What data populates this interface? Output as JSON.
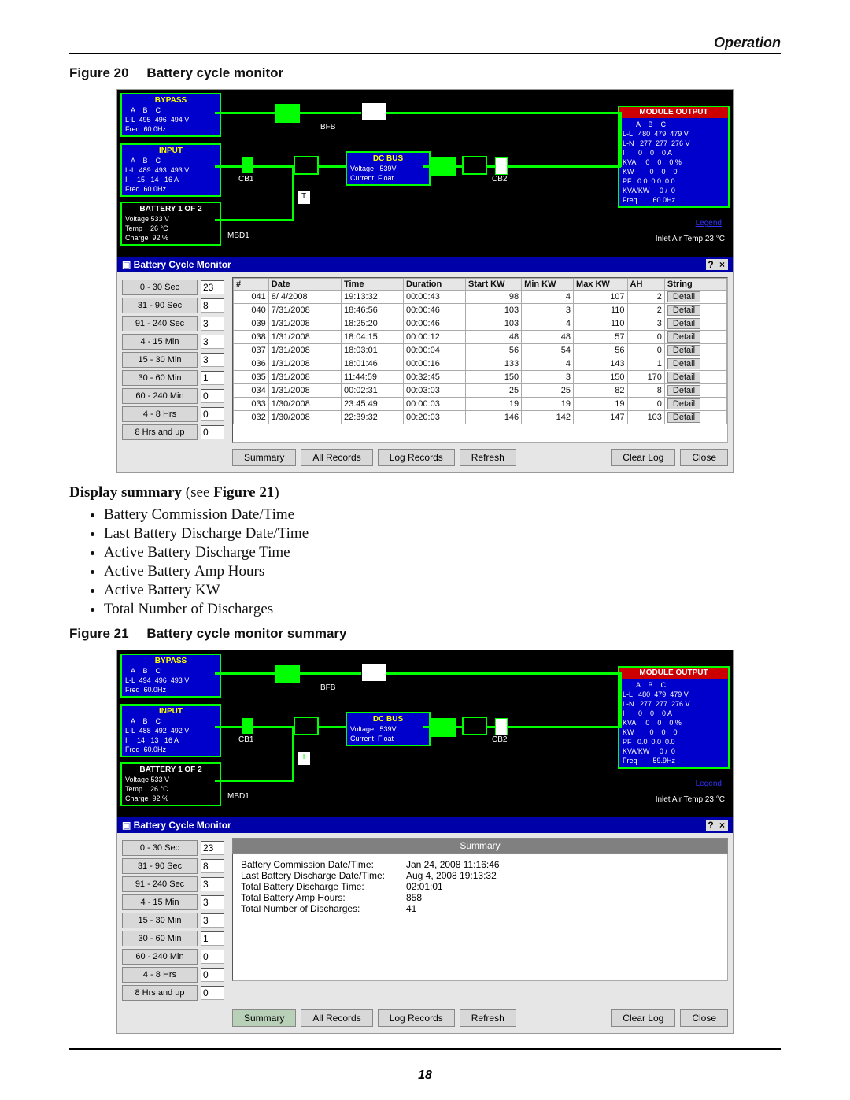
{
  "header": {
    "operation": "Operation"
  },
  "fig20": {
    "no": "Figure 20",
    "title": "Battery cycle monitor"
  },
  "fig21": {
    "no": "Figure 21",
    "title": "Battery cycle monitor summary"
  },
  "summary_heading": {
    "lead": "Display summary",
    "paren": " (see ",
    "ref": "Figure 21",
    "close": ")"
  },
  "bullets": [
    "Battery Commission Date/Time",
    "Last Battery Discharge Date/Time",
    "Active Battery Discharge Time",
    "Active Battery Amp Hours",
    "Active Battery KW",
    "Total Number of Discharges"
  ],
  "mimic": {
    "bypass": {
      "title": "BYPASS",
      "cols": "   A    B    C",
      "ll": "L-L  495  496  494 V",
      "freq": "Freq  60.0Hz"
    },
    "bypass2": {
      "title": "BYPASS",
      "cols": "   A    B    C",
      "ll": "L-L  494  496  493 V",
      "freq": "Freq  60.0Hz"
    },
    "input": {
      "title": "INPUT",
      "cols": "   A    B    C",
      "ll": "L-L  489  493  493 V",
      "i": "I     15   14   16 A",
      "freq": "Freq  60.0Hz"
    },
    "input2": {
      "title": "INPUT",
      "cols": "   A    B    C",
      "ll": "L-L  488  492  492 V",
      "i": "I     14   13   16 A",
      "freq": "Freq  60.0Hz"
    },
    "dcbus": {
      "title": "DC BUS",
      "v": "Voltage   539V",
      "c": "Current  Float"
    },
    "mod": {
      "title": "MODULE OUTPUT",
      "cols": "       A    B    C",
      "ll": "L-L   480  479  479 V",
      "ln": "L-N   277  277  276 V",
      "i": "I       0    0    0 A",
      "kva": "KVA     0    0    0 %",
      "kw": "KW        0    0    0",
      "pf": "PF   0.0  0.0  0.0",
      "kvakw": "KVA/KW     0 /  0",
      "freq": "Freq        60.0Hz"
    },
    "mod2": {
      "title": "MODULE OUTPUT",
      "cols": "       A    B    C",
      "ll": "L-L   480  479  479 V",
      "ln": "L-N   277  277  276 V",
      "i": "I       0    0    0 A",
      "kva": "KVA     0    0    0 %",
      "kw": "KW        0    0    0",
      "pf": "PF   0.0  0.0  0.0",
      "kvakw": "KVA/KW     0 /  0",
      "freq": "Freq        59.9Hz"
    },
    "bat": {
      "title": "BATTERY 1 OF 2",
      "v": "Voltage 533 V",
      "t": "Temp    26 °C",
      "c": "Charge  92 %"
    },
    "labels": {
      "bfb": "BFB",
      "cb1": "CB1",
      "cb2": "CB2",
      "mbd1": "MBD1",
      "t": "T",
      "legend": "Legend",
      "inlet": "Inlet Air Temp 23 °C"
    }
  },
  "bcm": {
    "title": "Battery Cycle Monitor",
    "winicons": "? ×",
    "bins": [
      {
        "label": "0 - 30 Sec",
        "count": "23"
      },
      {
        "label": "31 - 90 Sec",
        "count": "8"
      },
      {
        "label": "91 - 240 Sec",
        "count": "3"
      },
      {
        "label": "4 - 15 Min",
        "count": "3"
      },
      {
        "label": "15 - 30 Min",
        "count": "3"
      },
      {
        "label": "30 - 60 Min",
        "count": "1"
      },
      {
        "label": "60 - 240 Min",
        "count": "0"
      },
      {
        "label": "4 -  8 Hrs",
        "count": "0"
      },
      {
        "label": "8 Hrs and up",
        "count": "0"
      }
    ],
    "cols": [
      "#",
      "Date",
      "Time",
      "Duration",
      "Start KW",
      "Min KW",
      "Max KW",
      "AH",
      "String"
    ],
    "rows": [
      {
        "n": "041",
        "date": "8/ 4/2008",
        "time": "19:13:32",
        "dur": "00:00:43",
        "s": "98",
        "min": "4",
        "max": "107",
        "ah": "2"
      },
      {
        "n": "040",
        "date": "7/31/2008",
        "time": "18:46:56",
        "dur": "00:00:46",
        "s": "103",
        "min": "3",
        "max": "110",
        "ah": "2"
      },
      {
        "n": "039",
        "date": "1/31/2008",
        "time": "18:25:20",
        "dur": "00:00:46",
        "s": "103",
        "min": "4",
        "max": "110",
        "ah": "3"
      },
      {
        "n": "038",
        "date": "1/31/2008",
        "time": "18:04:15",
        "dur": "00:00:12",
        "s": "48",
        "min": "48",
        "max": "57",
        "ah": "0"
      },
      {
        "n": "037",
        "date": "1/31/2008",
        "time": "18:03:01",
        "dur": "00:00:04",
        "s": "56",
        "min": "54",
        "max": "56",
        "ah": "0"
      },
      {
        "n": "036",
        "date": "1/31/2008",
        "time": "18:01:46",
        "dur": "00:00:16",
        "s": "133",
        "min": "4",
        "max": "143",
        "ah": "1"
      },
      {
        "n": "035",
        "date": "1/31/2008",
        "time": "11:44:59",
        "dur": "00:32:45",
        "s": "150",
        "min": "3",
        "max": "150",
        "ah": "170"
      },
      {
        "n": "034",
        "date": "1/31/2008",
        "time": "00:02:31",
        "dur": "00:03:03",
        "s": "25",
        "min": "25",
        "max": "82",
        "ah": "8"
      },
      {
        "n": "033",
        "date": "1/30/2008",
        "time": "23:45:49",
        "dur": "00:00:03",
        "s": "19",
        "min": "19",
        "max": "19",
        "ah": "0"
      },
      {
        "n": "032",
        "date": "1/30/2008",
        "time": "22:39:32",
        "dur": "00:20:03",
        "s": "146",
        "min": "142",
        "max": "147",
        "ah": "103"
      }
    ],
    "detail": "Detail",
    "buttons": {
      "summary": "Summary",
      "all": "All Records",
      "log": "Log Records",
      "refresh": "Refresh",
      "clear": "Clear Log",
      "close": "Close"
    }
  },
  "summary": {
    "hdr": "Summary",
    "rows": [
      {
        "k": "Battery Commission Date/Time:",
        "v": "Jan 24, 2008  11:16:46"
      },
      {
        "k": "Last Battery Discharge Date/Time:",
        "v": "Aug  4, 2008  19:13:32"
      },
      {
        "k": "Total Battery Discharge Time:",
        "v": "02:01:01"
      },
      {
        "k": "Total Battery Amp Hours:",
        "v": "858"
      },
      {
        "k": "Total Number of Discharges:",
        "v": "41"
      }
    ]
  },
  "page_number": "18"
}
